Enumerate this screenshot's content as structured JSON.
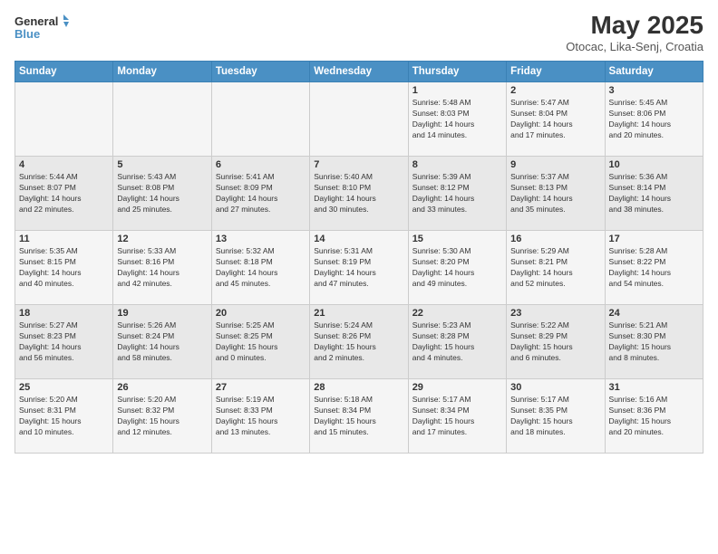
{
  "logo": {
    "line1": "General",
    "line2": "Blue"
  },
  "title": "May 2025",
  "subtitle": "Otocac, Lika-Senj, Croatia",
  "days_of_week": [
    "Sunday",
    "Monday",
    "Tuesday",
    "Wednesday",
    "Thursday",
    "Friday",
    "Saturday"
  ],
  "weeks": [
    [
      {
        "day": "",
        "info": ""
      },
      {
        "day": "",
        "info": ""
      },
      {
        "day": "",
        "info": ""
      },
      {
        "day": "",
        "info": ""
      },
      {
        "day": "1",
        "info": "Sunrise: 5:48 AM\nSunset: 8:03 PM\nDaylight: 14 hours\nand 14 minutes."
      },
      {
        "day": "2",
        "info": "Sunrise: 5:47 AM\nSunset: 8:04 PM\nDaylight: 14 hours\nand 17 minutes."
      },
      {
        "day": "3",
        "info": "Sunrise: 5:45 AM\nSunset: 8:06 PM\nDaylight: 14 hours\nand 20 minutes."
      }
    ],
    [
      {
        "day": "4",
        "info": "Sunrise: 5:44 AM\nSunset: 8:07 PM\nDaylight: 14 hours\nand 22 minutes."
      },
      {
        "day": "5",
        "info": "Sunrise: 5:43 AM\nSunset: 8:08 PM\nDaylight: 14 hours\nand 25 minutes."
      },
      {
        "day": "6",
        "info": "Sunrise: 5:41 AM\nSunset: 8:09 PM\nDaylight: 14 hours\nand 27 minutes."
      },
      {
        "day": "7",
        "info": "Sunrise: 5:40 AM\nSunset: 8:10 PM\nDaylight: 14 hours\nand 30 minutes."
      },
      {
        "day": "8",
        "info": "Sunrise: 5:39 AM\nSunset: 8:12 PM\nDaylight: 14 hours\nand 33 minutes."
      },
      {
        "day": "9",
        "info": "Sunrise: 5:37 AM\nSunset: 8:13 PM\nDaylight: 14 hours\nand 35 minutes."
      },
      {
        "day": "10",
        "info": "Sunrise: 5:36 AM\nSunset: 8:14 PM\nDaylight: 14 hours\nand 38 minutes."
      }
    ],
    [
      {
        "day": "11",
        "info": "Sunrise: 5:35 AM\nSunset: 8:15 PM\nDaylight: 14 hours\nand 40 minutes."
      },
      {
        "day": "12",
        "info": "Sunrise: 5:33 AM\nSunset: 8:16 PM\nDaylight: 14 hours\nand 42 minutes."
      },
      {
        "day": "13",
        "info": "Sunrise: 5:32 AM\nSunset: 8:18 PM\nDaylight: 14 hours\nand 45 minutes."
      },
      {
        "day": "14",
        "info": "Sunrise: 5:31 AM\nSunset: 8:19 PM\nDaylight: 14 hours\nand 47 minutes."
      },
      {
        "day": "15",
        "info": "Sunrise: 5:30 AM\nSunset: 8:20 PM\nDaylight: 14 hours\nand 49 minutes."
      },
      {
        "day": "16",
        "info": "Sunrise: 5:29 AM\nSunset: 8:21 PM\nDaylight: 14 hours\nand 52 minutes."
      },
      {
        "day": "17",
        "info": "Sunrise: 5:28 AM\nSunset: 8:22 PM\nDaylight: 14 hours\nand 54 minutes."
      }
    ],
    [
      {
        "day": "18",
        "info": "Sunrise: 5:27 AM\nSunset: 8:23 PM\nDaylight: 14 hours\nand 56 minutes."
      },
      {
        "day": "19",
        "info": "Sunrise: 5:26 AM\nSunset: 8:24 PM\nDaylight: 14 hours\nand 58 minutes."
      },
      {
        "day": "20",
        "info": "Sunrise: 5:25 AM\nSunset: 8:25 PM\nDaylight: 15 hours\nand 0 minutes."
      },
      {
        "day": "21",
        "info": "Sunrise: 5:24 AM\nSunset: 8:26 PM\nDaylight: 15 hours\nand 2 minutes."
      },
      {
        "day": "22",
        "info": "Sunrise: 5:23 AM\nSunset: 8:28 PM\nDaylight: 15 hours\nand 4 minutes."
      },
      {
        "day": "23",
        "info": "Sunrise: 5:22 AM\nSunset: 8:29 PM\nDaylight: 15 hours\nand 6 minutes."
      },
      {
        "day": "24",
        "info": "Sunrise: 5:21 AM\nSunset: 8:30 PM\nDaylight: 15 hours\nand 8 minutes."
      }
    ],
    [
      {
        "day": "25",
        "info": "Sunrise: 5:20 AM\nSunset: 8:31 PM\nDaylight: 15 hours\nand 10 minutes."
      },
      {
        "day": "26",
        "info": "Sunrise: 5:20 AM\nSunset: 8:32 PM\nDaylight: 15 hours\nand 12 minutes."
      },
      {
        "day": "27",
        "info": "Sunrise: 5:19 AM\nSunset: 8:33 PM\nDaylight: 15 hours\nand 13 minutes."
      },
      {
        "day": "28",
        "info": "Sunrise: 5:18 AM\nSunset: 8:34 PM\nDaylight: 15 hours\nand 15 minutes."
      },
      {
        "day": "29",
        "info": "Sunrise: 5:17 AM\nSunset: 8:34 PM\nDaylight: 15 hours\nand 17 minutes."
      },
      {
        "day": "30",
        "info": "Sunrise: 5:17 AM\nSunset: 8:35 PM\nDaylight: 15 hours\nand 18 minutes."
      },
      {
        "day": "31",
        "info": "Sunrise: 5:16 AM\nSunset: 8:36 PM\nDaylight: 15 hours\nand 20 minutes."
      }
    ]
  ]
}
